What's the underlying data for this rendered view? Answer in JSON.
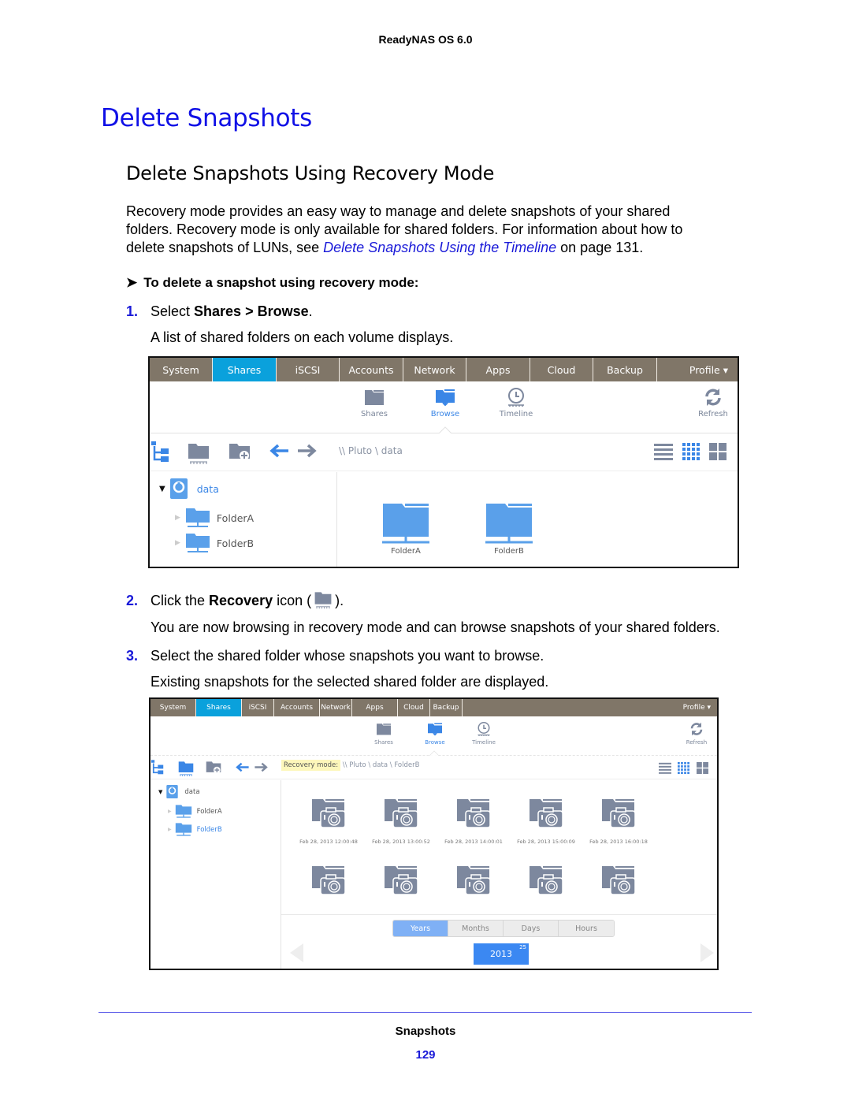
{
  "running_head": "ReadyNAS OS 6.0",
  "title": "Delete Snapshots",
  "section_title": "Delete Snapshots Using Recovery Mode",
  "intro": {
    "line1": "Recovery mode provides an easy way to manage and delete snapshots of your shared",
    "line2": "folders. Recovery mode is only available for shared folders. For information about how to",
    "line3_before": "delete snapshots of LUNs, see ",
    "line3_link": "Delete Snapshots Using the Timeline",
    "line3_after": " on page 131."
  },
  "procedure_heading": "To delete a snapshot using recovery mode:",
  "steps": [
    {
      "num": "1.",
      "pre": "Select ",
      "bold": "Shares > Browse",
      "post": ".",
      "result": "A list of shared folders on each volume displays."
    },
    {
      "num": "2.",
      "pre": "Click the ",
      "bold": "Recovery",
      "post_a": " icon (",
      "post_b": ").",
      "result": "You are now browsing in recovery mode and can browse snapshots of your shared folders."
    },
    {
      "num": "3.",
      "text": "Select the shared folder whose snapshots you want to browse.",
      "result": "Existing snapshots for the selected shared folder are displayed."
    }
  ],
  "ui": {
    "nav_tabs": [
      "System",
      "Shares",
      "iSCSI",
      "Accounts",
      "Network",
      "Apps",
      "Cloud",
      "Backup"
    ],
    "active_tab": "Shares",
    "profile": "Profile ▾",
    "subnav": {
      "shares": "Shares",
      "browse": "Browse",
      "timeline": "Timeline",
      "refresh": "Refresh"
    },
    "colors": {
      "nav_bg": "#807668",
      "active_tab": "#0aa1dc",
      "icon_blue": "#5aa0ea",
      "icon_gray": "#7d889e"
    }
  },
  "screen1": {
    "path": "\\\\ Pluto \\ data",
    "tree": {
      "root": "data",
      "children": [
        "FolderA",
        "FolderB"
      ]
    },
    "folders": [
      "FolderA",
      "FolderB"
    ]
  },
  "screen2": {
    "recovery_label": "Recovery mode:",
    "path": "\\\\ Pluto \\ data \\ FolderB",
    "tree": {
      "root": "data",
      "children": [
        "FolderA",
        "FolderB"
      ],
      "selected": "FolderB"
    },
    "snapshots_row1": [
      "Feb 28, 2013 12:00:48",
      "Feb 28, 2013 13:00:52",
      "Feb 28, 2013 14:00:01",
      "Feb 28, 2013 15:00:09",
      "Feb 28, 2013 16:00:18"
    ],
    "snapshots_row2_count": 5,
    "time_scale": [
      "Years",
      "Months",
      "Days",
      "Hours"
    ],
    "active_scale": "Years",
    "year": "2013",
    "year_count": "25"
  },
  "footer": {
    "title": "Snapshots",
    "page": "129"
  }
}
